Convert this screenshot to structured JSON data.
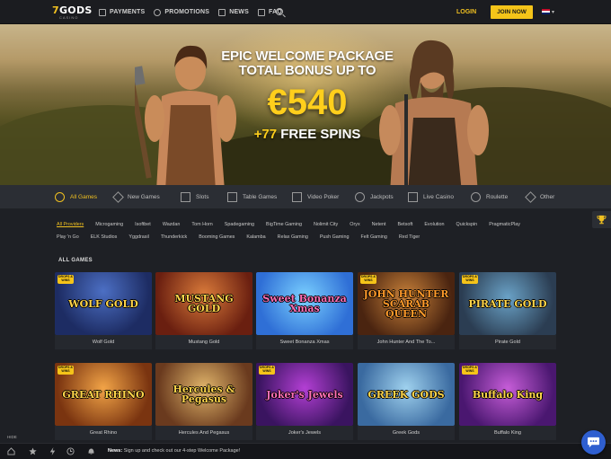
{
  "header": {
    "logo_main_num": "7",
    "logo_main_text": "GODS",
    "logo_sub": "CASINO",
    "nav": [
      {
        "label": "PAYMENTS",
        "icon": "payments-icon"
      },
      {
        "label": "PROMOTIONS",
        "icon": "promotions-icon"
      },
      {
        "label": "NEWS",
        "icon": "news-icon"
      },
      {
        "label": "FAQ",
        "icon": "faq-icon"
      }
    ],
    "login_label": "LOGIN",
    "join_label": "JOIN NOW",
    "language": "en-flag"
  },
  "hero": {
    "line1": "EPIC WELCOME PACKAGE",
    "line2": "TOTAL BONUS UP TO",
    "amount": "€540",
    "spins_prefix": "+77",
    "spins_text": "FREE SPINS"
  },
  "categories": [
    {
      "label": "All Games",
      "icon": "all-games-icon",
      "active": true
    },
    {
      "label": "New Games",
      "icon": "diamond-icon"
    },
    {
      "label": "Slots",
      "icon": "slots-icon"
    },
    {
      "label": "Table Games",
      "icon": "table-games-icon"
    },
    {
      "label": "Video Poker",
      "icon": "video-poker-icon"
    },
    {
      "label": "Jackpots",
      "icon": "jackpots-icon"
    },
    {
      "label": "Live Casino",
      "icon": "live-casino-icon"
    },
    {
      "label": "Roulette",
      "icon": "roulette-icon"
    },
    {
      "label": "Other",
      "icon": "other-icon"
    }
  ],
  "providers_row1": [
    "All Providers",
    "Microgaming",
    "Isoftbet",
    "Wazdan",
    "Tom Horn",
    "Spadegaming",
    "BigTime Gaming",
    "Nolimit City",
    "Oryx",
    "Netent",
    "Betsoft",
    "Evolution",
    "Quickspin",
    "PragmaticPlay"
  ],
  "providers_row2": [
    "Play 'n Go",
    "ELK Studios",
    "Yggdrasil",
    "Thunderkick",
    "Booming Games",
    "Kalamba",
    "Relax Gaming",
    "Push Gaming",
    "Felt Gaming",
    "Red Tiger"
  ],
  "section_title": "ALL GAMES",
  "badge_text": "DROPS & WINS",
  "games": [
    {
      "name": "Wolf Gold",
      "art_title": "WOLF GOLD",
      "badge": true
    },
    {
      "name": "Mustang Gold",
      "art_title": "MUSTANG GOLD",
      "badge": false
    },
    {
      "name": "Sweet Bonanza Xmas",
      "art_title": "Sweet Bonanza Xmas",
      "badge": false
    },
    {
      "name": "John Hunter And The To...",
      "art_title": "JOHN HUNTER SCARAB QUEEN",
      "badge": true
    },
    {
      "name": "Pirate Gold",
      "art_title": "PIRATE GOLD",
      "badge": true
    },
    {
      "name": "Great Rhino",
      "art_title": "GREAT RHINO",
      "badge": true
    },
    {
      "name": "Hercules And Pegasus",
      "art_title": "Hercules & Pegasus",
      "badge": false
    },
    {
      "name": "Joker's Jewels",
      "art_title": "Joker's Jewels",
      "badge": true
    },
    {
      "name": "Greek Gods",
      "art_title": "GREEK GODS",
      "badge": false
    },
    {
      "name": "Buffalo King",
      "art_title": "Buffalo King",
      "badge": true
    }
  ],
  "footer": {
    "hide_label": "HIDE",
    "news_label": "News:",
    "news_text": "Sign up and check out our 4-step Welcome Package!"
  }
}
